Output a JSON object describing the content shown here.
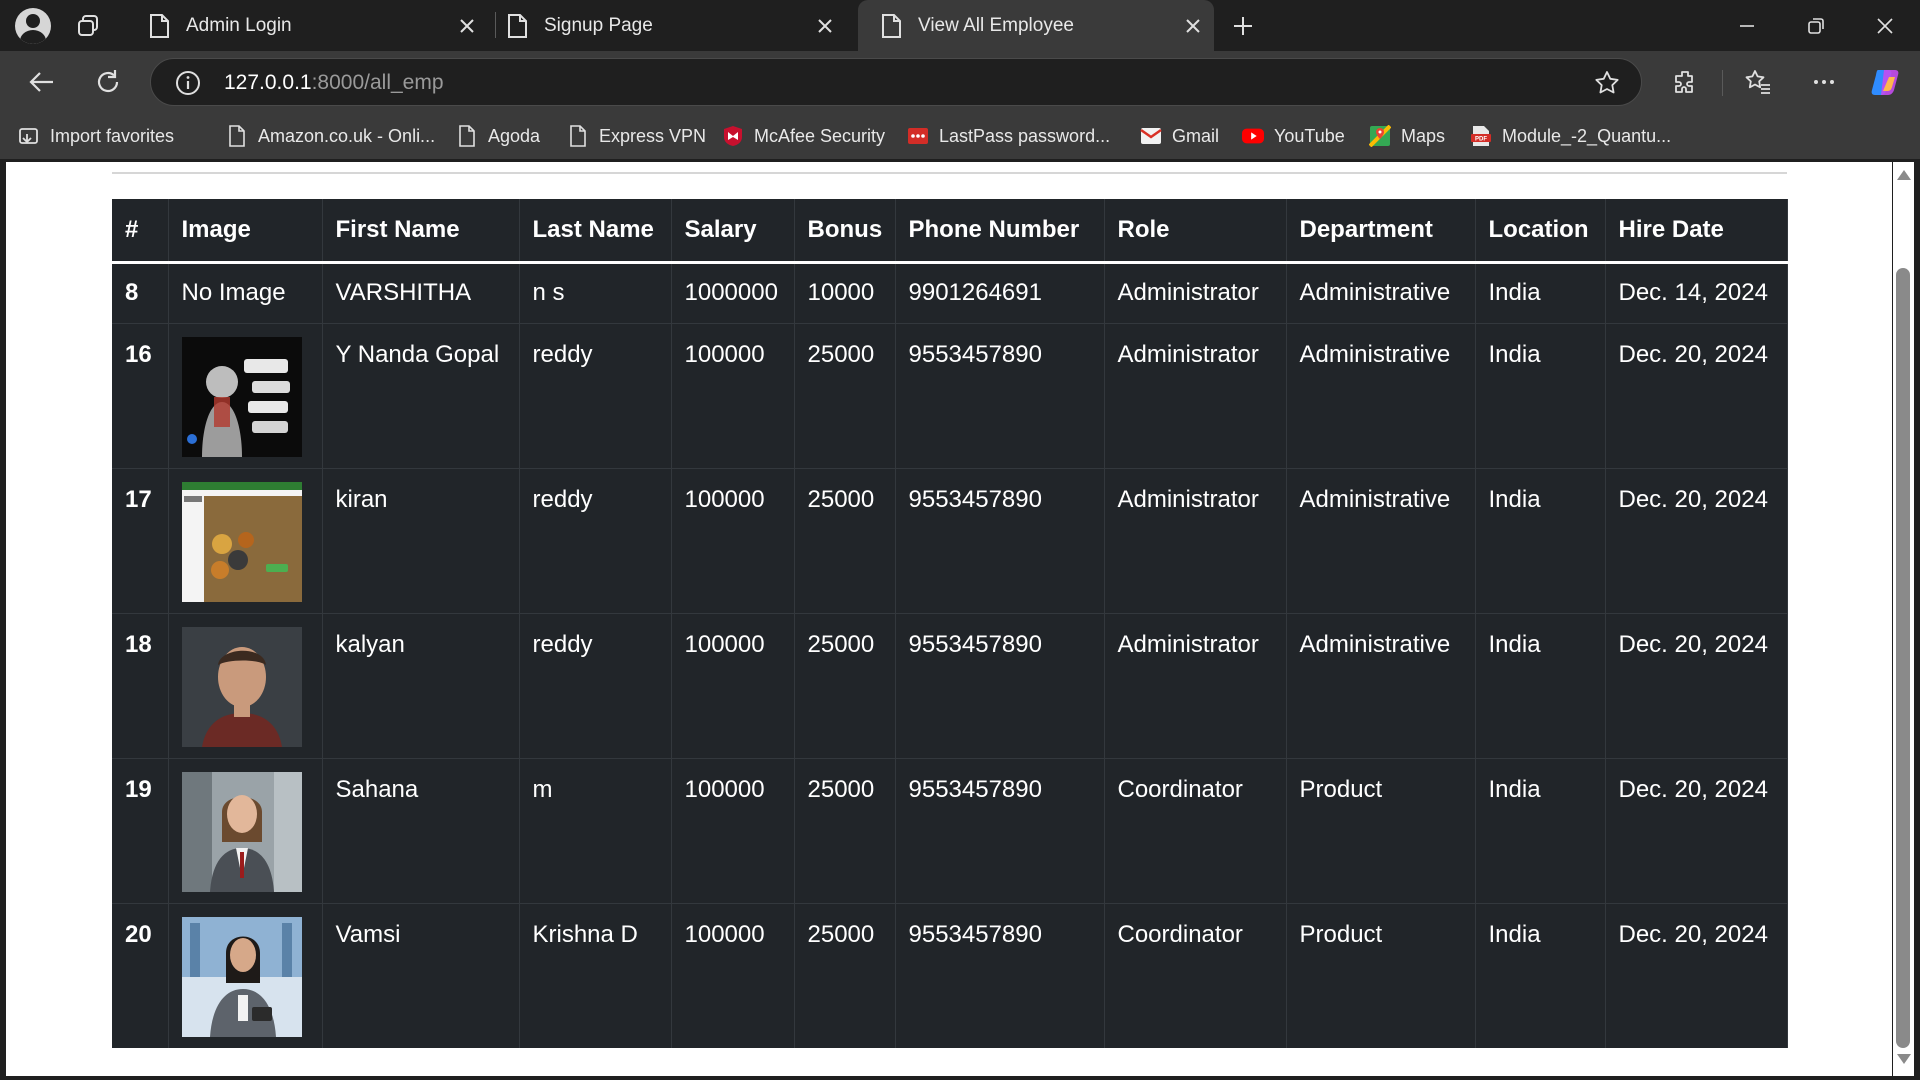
{
  "browser": {
    "tabs": [
      {
        "title": "Admin Login",
        "active": false
      },
      {
        "title": "Signup Page",
        "active": false
      },
      {
        "title": "View All Employee",
        "active": true
      }
    ],
    "address": {
      "host": "127.0.0.1",
      "path": ":8000/all_emp"
    },
    "favorites": [
      {
        "label": "Import favorites",
        "icon": "import-favorites-icon"
      },
      {
        "label": "Amazon.co.uk - Onli...",
        "icon": "page-icon"
      },
      {
        "label": "Agoda",
        "icon": "page-icon"
      },
      {
        "label": "Express VPN",
        "icon": "page-icon"
      },
      {
        "label": "McAfee Security",
        "icon": "mcafee-icon"
      },
      {
        "label": "LastPass password...",
        "icon": "lastpass-icon"
      },
      {
        "label": "Gmail",
        "icon": "gmail-icon"
      },
      {
        "label": "YouTube",
        "icon": "youtube-icon"
      },
      {
        "label": "Maps",
        "icon": "maps-icon"
      },
      {
        "label": "Module_-2_Quantu...",
        "icon": "pdf-icon"
      }
    ]
  },
  "table": {
    "headers": [
      "#",
      "Image",
      "First Name",
      "Last Name",
      "Salary",
      "Bonus",
      "Phone Number",
      "Role",
      "Department",
      "Location",
      "Hire Date"
    ],
    "rows": [
      {
        "id": "8",
        "image": "No Image",
        "first": "VARSHITHA",
        "last": "n s",
        "salary": "1000000",
        "bonus": "10000",
        "phone": "9901264691",
        "role": "Administrator",
        "dept": "Administrative",
        "location": "India",
        "hire": "Dec. 14, 2024"
      },
      {
        "id": "16",
        "image": "",
        "first": "Y Nanda Gopal",
        "last": "reddy",
        "salary": "100000",
        "bonus": "25000",
        "phone": "9553457890",
        "role": "Administrator",
        "dept": "Administrative",
        "location": "India",
        "hire": "Dec. 20, 2024"
      },
      {
        "id": "17",
        "image": "",
        "first": "kiran",
        "last": "reddy",
        "salary": "100000",
        "bonus": "25000",
        "phone": "9553457890",
        "role": "Administrator",
        "dept": "Administrative",
        "location": "India",
        "hire": "Dec. 20, 2024"
      },
      {
        "id": "18",
        "image": "",
        "first": "kalyan",
        "last": "reddy",
        "salary": "100000",
        "bonus": "25000",
        "phone": "9553457890",
        "role": "Administrator",
        "dept": "Administrative",
        "location": "India",
        "hire": "Dec. 20, 2024"
      },
      {
        "id": "19",
        "image": "",
        "first": "Sahana",
        "last": "m",
        "salary": "100000",
        "bonus": "25000",
        "phone": "9553457890",
        "role": "Coordinator",
        "dept": "Product",
        "location": "India",
        "hire": "Dec. 20, 2024"
      },
      {
        "id": "20",
        "image": "",
        "first": "Vamsi",
        "last": "Krishna D",
        "salary": "100000",
        "bonus": "25000",
        "phone": "9553457890",
        "role": "Coordinator",
        "dept": "Product",
        "location": "India",
        "hire": "Dec. 20, 2024"
      }
    ]
  },
  "colors": {
    "table_bg": "#212529",
    "browser_dark": "#1f1f1f",
    "toolbar": "#3a3a3a",
    "page_bg": "#ffffff"
  }
}
